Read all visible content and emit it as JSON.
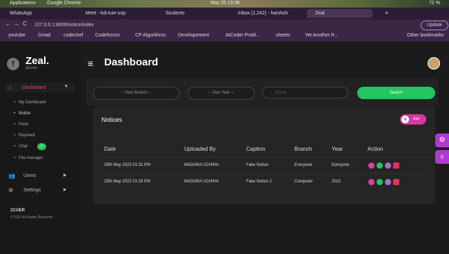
{
  "os": {
    "applications": "Applications",
    "active_app": "Google Chrome",
    "clock": "May 25  13:38",
    "battery": "72 %"
  },
  "browser": {
    "tabs": [
      {
        "label": "WhatsApp"
      },
      {
        "label": "Meet - kdi-tuie-uxp"
      },
      {
        "label": "Students"
      },
      {
        "label": "Inbox (1,242) - harshsh"
      },
      {
        "label": "Zeal"
      }
    ],
    "url": "127.0.0.1:8000/notice/index",
    "update_label": "Update",
    "bookmarks": [
      "youtube",
      "Gmail",
      "codechef",
      "Codeforces",
      "CP Algorithms",
      "Developement",
      "AtCoder Probl...",
      "sheets",
      "Yet Another R..."
    ],
    "other_bookmarks": "Other bookmarks"
  },
  "brand": {
    "name": "Zeal.",
    "user": "@zcoer"
  },
  "sidebar": {
    "dashboard": "Dashboard",
    "items": [
      {
        "label": "My Dashboard"
      },
      {
        "label": "Notice"
      },
      {
        "label": "Feed"
      },
      {
        "label": "Payment"
      },
      {
        "label": "Chat",
        "badge": "0"
      },
      {
        "label": "File-manager"
      }
    ],
    "users": "Users",
    "settings": "Settings",
    "footer_title": "ZCOER",
    "footer_copy": "© 2022 All Rights Reserved"
  },
  "header": {
    "title": "Dashboard"
  },
  "filters": {
    "branch": "-- Your Branch --",
    "year": "-- Your Year --",
    "name_placeholder": "Name",
    "search_label": "Search"
  },
  "notices": {
    "title": "Notices",
    "add_label": "Add",
    "columns": [
      "Date",
      "Uploaded By",
      "Caption",
      "Branch",
      "Year",
      "Action"
    ],
    "rows": [
      {
        "date": "25th May 2022 01:31 PM",
        "uploaded_by": "MADARA UCHIHA",
        "caption": "Fake Notice",
        "branch": "Everyone",
        "year": "Everyone"
      },
      {
        "date": "25th May 2022 01:33 PM",
        "uploaded_by": "MADARA UCHIHA",
        "caption": "Fake Notice 2",
        "branch": "Computer",
        "year": "2021"
      }
    ]
  },
  "colors": {
    "accent": "#d63aa0",
    "search": "#22c55e",
    "sidebar_active": "#e0407a",
    "float": "#b03ad0"
  }
}
